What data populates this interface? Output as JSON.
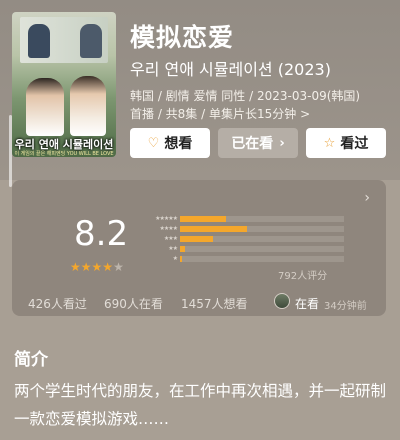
{
  "header": {
    "title": "模拟恋爱",
    "original_title": "우리 연애 시뮬레이션 (2023)",
    "meta_line1": "韩国 / 剧情 爱情 同性 / 2023-03-09(韩国)",
    "meta_line2": "首播 / 共8集 / 单集片长15分钟 >"
  },
  "poster": {
    "caption": "우리 연애 시뮬레이션",
    "subtitle": "이 게임의 끝은 해피엔딩 YOU WILL BE LOVE"
  },
  "actions": {
    "want_label": "想看",
    "doing_label": "已在看",
    "done_label": "看过",
    "want_icon": "heart-plus-icon",
    "doing_icon": "chevron-right-icon",
    "done_icon": "star-icon"
  },
  "rating": {
    "score": "8.2",
    "stars_filled": 4,
    "stars_total": 5,
    "distribution": [
      {
        "label": "★★★★★",
        "fraction": 0.28
      },
      {
        "label": "★★★★",
        "fraction": 0.41
      },
      {
        "label": "★★★",
        "fraction": 0.2
      },
      {
        "label": "★★",
        "fraction": 0.03
      },
      {
        "label": "★",
        "fraction": 0.01
      }
    ],
    "count_text": "792人评分"
  },
  "stats": {
    "watched": "426人看过",
    "watching": "690人在看",
    "want": "1457人想看"
  },
  "friend_activity": {
    "status": "在看",
    "time": "34分钟前"
  },
  "intro": {
    "heading": "简介",
    "text": "两个学生时代的朋友，在工作中再次相遇，并一起研制一款恋爱模拟游戏……"
  },
  "colors": {
    "background": "#a89f94",
    "card": "#8f867d",
    "accent_star": "#f4a72c"
  }
}
